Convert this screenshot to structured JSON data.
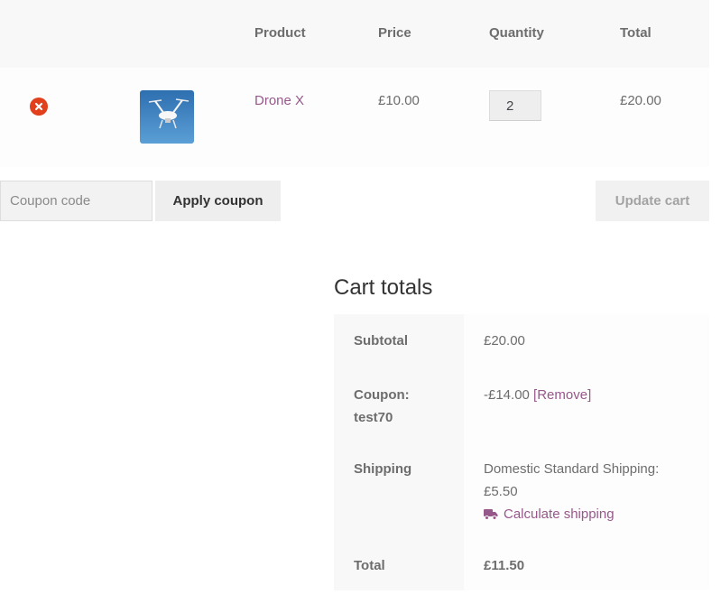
{
  "table": {
    "headers": {
      "product": "Product",
      "price": "Price",
      "quantity": "Quantity",
      "total": "Total"
    },
    "rows": [
      {
        "product": "Drone X",
        "price": "£10.00",
        "quantity": "2",
        "total": "£20.00"
      }
    ]
  },
  "actions": {
    "coupon_placeholder": "Coupon code",
    "apply_label": "Apply coupon",
    "update_label": "Update cart"
  },
  "totals": {
    "title": "Cart totals",
    "subtotal_label": "Subtotal",
    "subtotal_value": "£20.00",
    "coupon_label_1": "Coupon:",
    "coupon_label_2": "test70",
    "coupon_value": "-£14.00",
    "coupon_remove": "[Remove]",
    "shipping_label": "Shipping",
    "shipping_method": "Domestic Standard Shipping:",
    "shipping_price": "£5.50",
    "calculate_shipping": "Calculate shipping",
    "total_label": "Total",
    "total_value": "£11.50"
  },
  "colors": {
    "link": "#96588a",
    "remove": "#e2401c"
  },
  "icons": {
    "remove": "close-circle-icon",
    "shipping": "truck-icon"
  }
}
